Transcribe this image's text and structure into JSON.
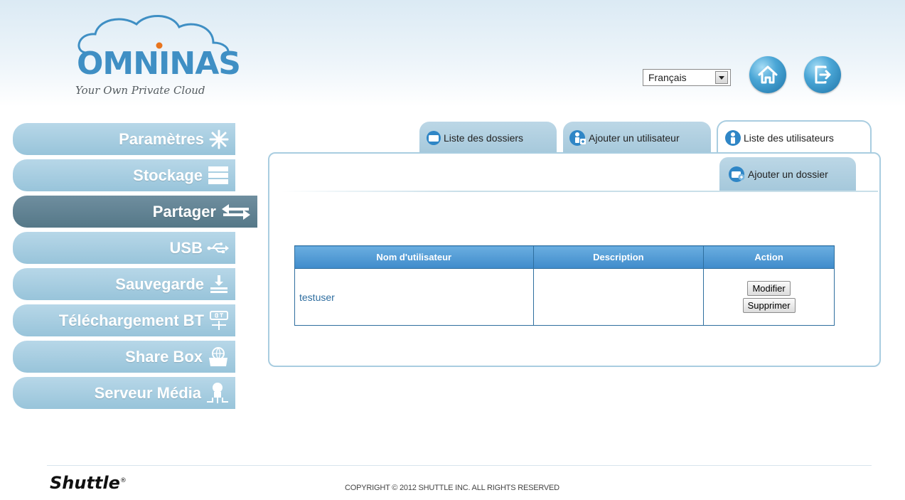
{
  "logo": {
    "name": "OMNINAS",
    "tagline": "Your Own Private Cloud"
  },
  "header": {
    "language": {
      "selected": "Français"
    },
    "home_icon": "home-icon",
    "logout_icon": "logout-icon"
  },
  "sidebar": {
    "items": [
      {
        "label": "Paramètres",
        "icon": "settings-icon",
        "active": false
      },
      {
        "label": "Stockage",
        "icon": "storage-icon",
        "active": false
      },
      {
        "label": "Partager",
        "icon": "share-arrows-icon",
        "active": true
      },
      {
        "label": "USB",
        "icon": "usb-icon",
        "active": false
      },
      {
        "label": "Sauvegarde",
        "icon": "backup-icon",
        "active": false
      },
      {
        "label": "Téléchargement BT",
        "icon": "bt-download-icon",
        "active": false
      },
      {
        "label": "Share Box",
        "icon": "share-box-icon",
        "active": false
      },
      {
        "label": "Serveur Média",
        "icon": "media-server-icon",
        "active": false
      }
    ]
  },
  "tabs": [
    {
      "label": "Liste des dossiers",
      "icon": "folder-list-icon",
      "active": false
    },
    {
      "label": "Ajouter un utilisateur",
      "icon": "add-user-icon",
      "active": false
    },
    {
      "label": "Liste des utilisateurs",
      "icon": "user-list-icon",
      "active": true
    }
  ],
  "subtab": {
    "label": "Ajouter un dossier",
    "icon": "add-folder-icon"
  },
  "table": {
    "headers": [
      "Nom d'utilisateur",
      "Description",
      "Action"
    ],
    "rows": [
      {
        "username": "testuser",
        "description": "",
        "actions": [
          "Modifier",
          "Supprimer"
        ]
      }
    ]
  },
  "footer": {
    "brand": "Shuttle",
    "brand_mark": "®",
    "copyright": "COPYRIGHT © 2012 SHUTTLE INC. ALL RIGHTS RESERVED"
  },
  "colors": {
    "sidebar": "#a8cde0",
    "sidebar_active": "#5f8293",
    "table_header": "#4f97d2",
    "accent": "#3f8fc4"
  }
}
